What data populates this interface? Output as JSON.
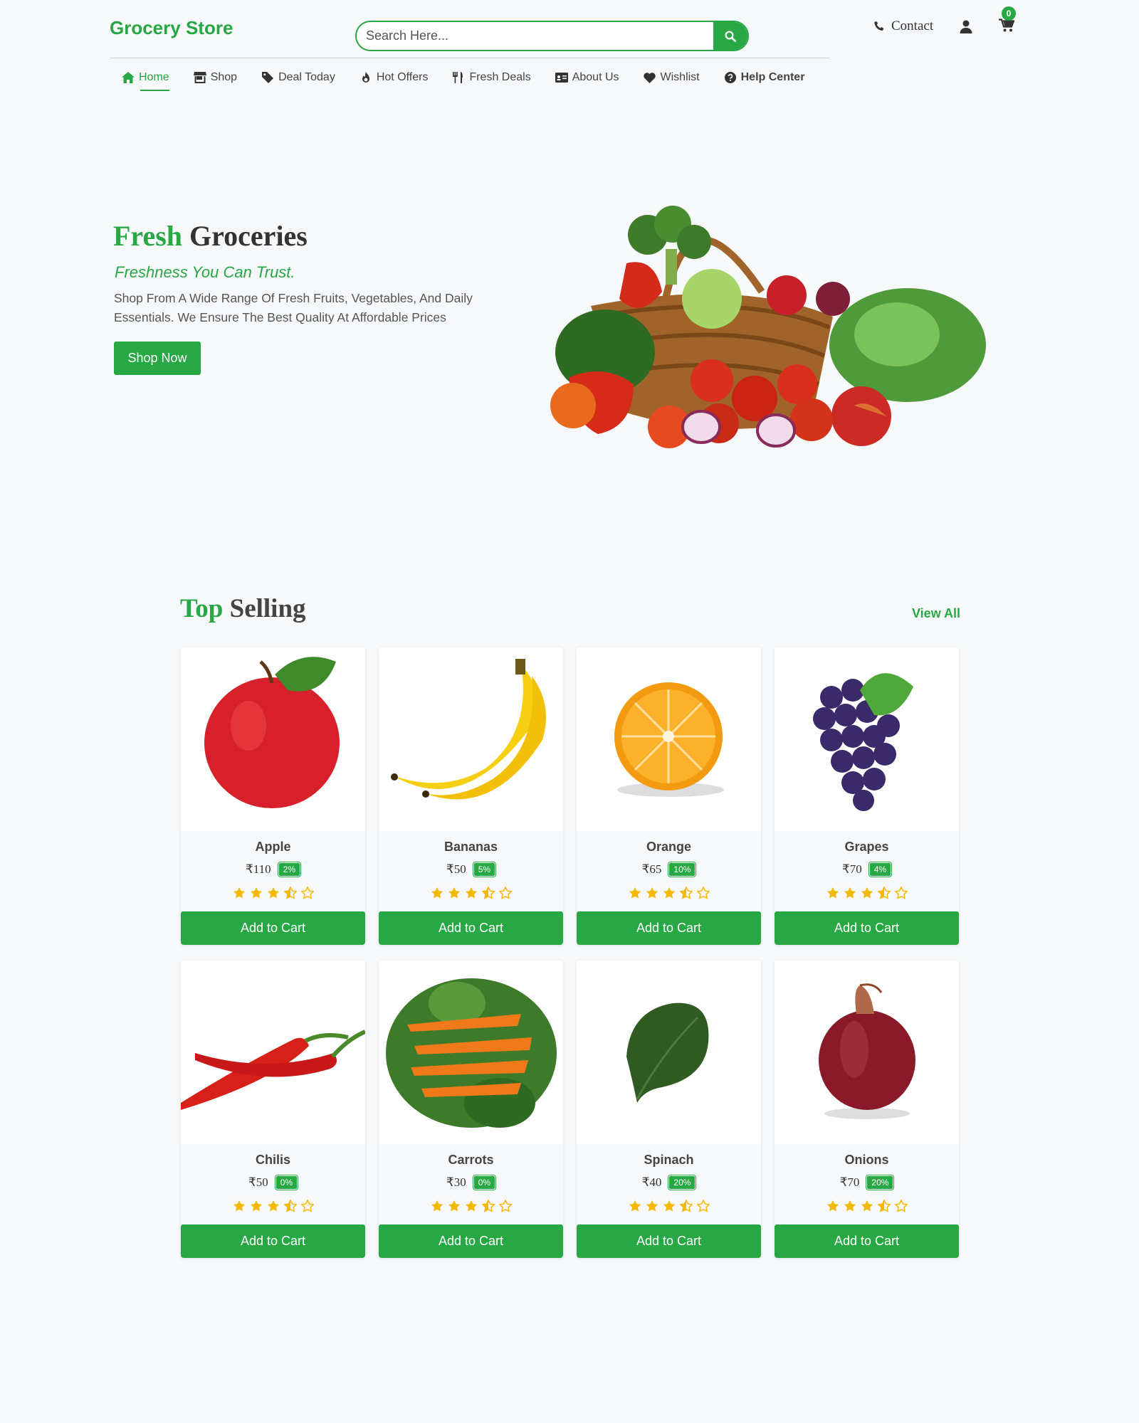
{
  "header": {
    "logo": "Grocery Store",
    "search_placeholder": "Search Here...",
    "contact_label": "Contact",
    "cart_count": "0"
  },
  "nav": {
    "items": [
      {
        "label": "Home",
        "icon": "home-icon"
      },
      {
        "label": "Shop",
        "icon": "store-icon"
      },
      {
        "label": "Deal Today",
        "icon": "tag-icon"
      },
      {
        "label": "Hot Offers",
        "icon": "fire-icon"
      },
      {
        "label": "Fresh Deals",
        "icon": "utensils-icon"
      },
      {
        "label": "About Us",
        "icon": "id-card-icon"
      },
      {
        "label": "Wishlist",
        "icon": "heart-icon"
      },
      {
        "label": "Help Center",
        "icon": "question-circle-icon"
      }
    ]
  },
  "hero": {
    "title_highlight": "Fresh",
    "title_rest": "Groceries",
    "subtitle": "Freshness You Can Trust.",
    "description": "Shop From A Wide Range Of Fresh Fruits, Vegetables, And Daily Essentials. We Ensure The Best Quality At Affordable Prices",
    "button": "Shop Now"
  },
  "top_selling": {
    "title_highlight": "Top",
    "title_rest": "Selling",
    "view_all": "View All",
    "add_to_cart": "Add to Cart",
    "products": [
      {
        "name": "Apple",
        "price": "₹110",
        "discount": "2%",
        "rating": 3.5
      },
      {
        "name": "Bananas",
        "price": "₹50",
        "discount": "5%",
        "rating": 3.5
      },
      {
        "name": "Orange",
        "price": "₹65",
        "discount": "10%",
        "rating": 3.5
      },
      {
        "name": "Grapes",
        "price": "₹70",
        "discount": "4%",
        "rating": 3.5
      },
      {
        "name": "Chilis",
        "price": "₹50",
        "discount": "0%",
        "rating": 3.5
      },
      {
        "name": "Carrots",
        "price": "₹30",
        "discount": "0%",
        "rating": 3.5
      },
      {
        "name": "Spinach",
        "price": "₹40",
        "discount": "20%",
        "rating": 3.5
      },
      {
        "name": "Onions",
        "price": "₹70",
        "discount": "20%",
        "rating": 3.5
      }
    ]
  },
  "colors": {
    "accent": "#28a745",
    "star": "#f5b800"
  }
}
